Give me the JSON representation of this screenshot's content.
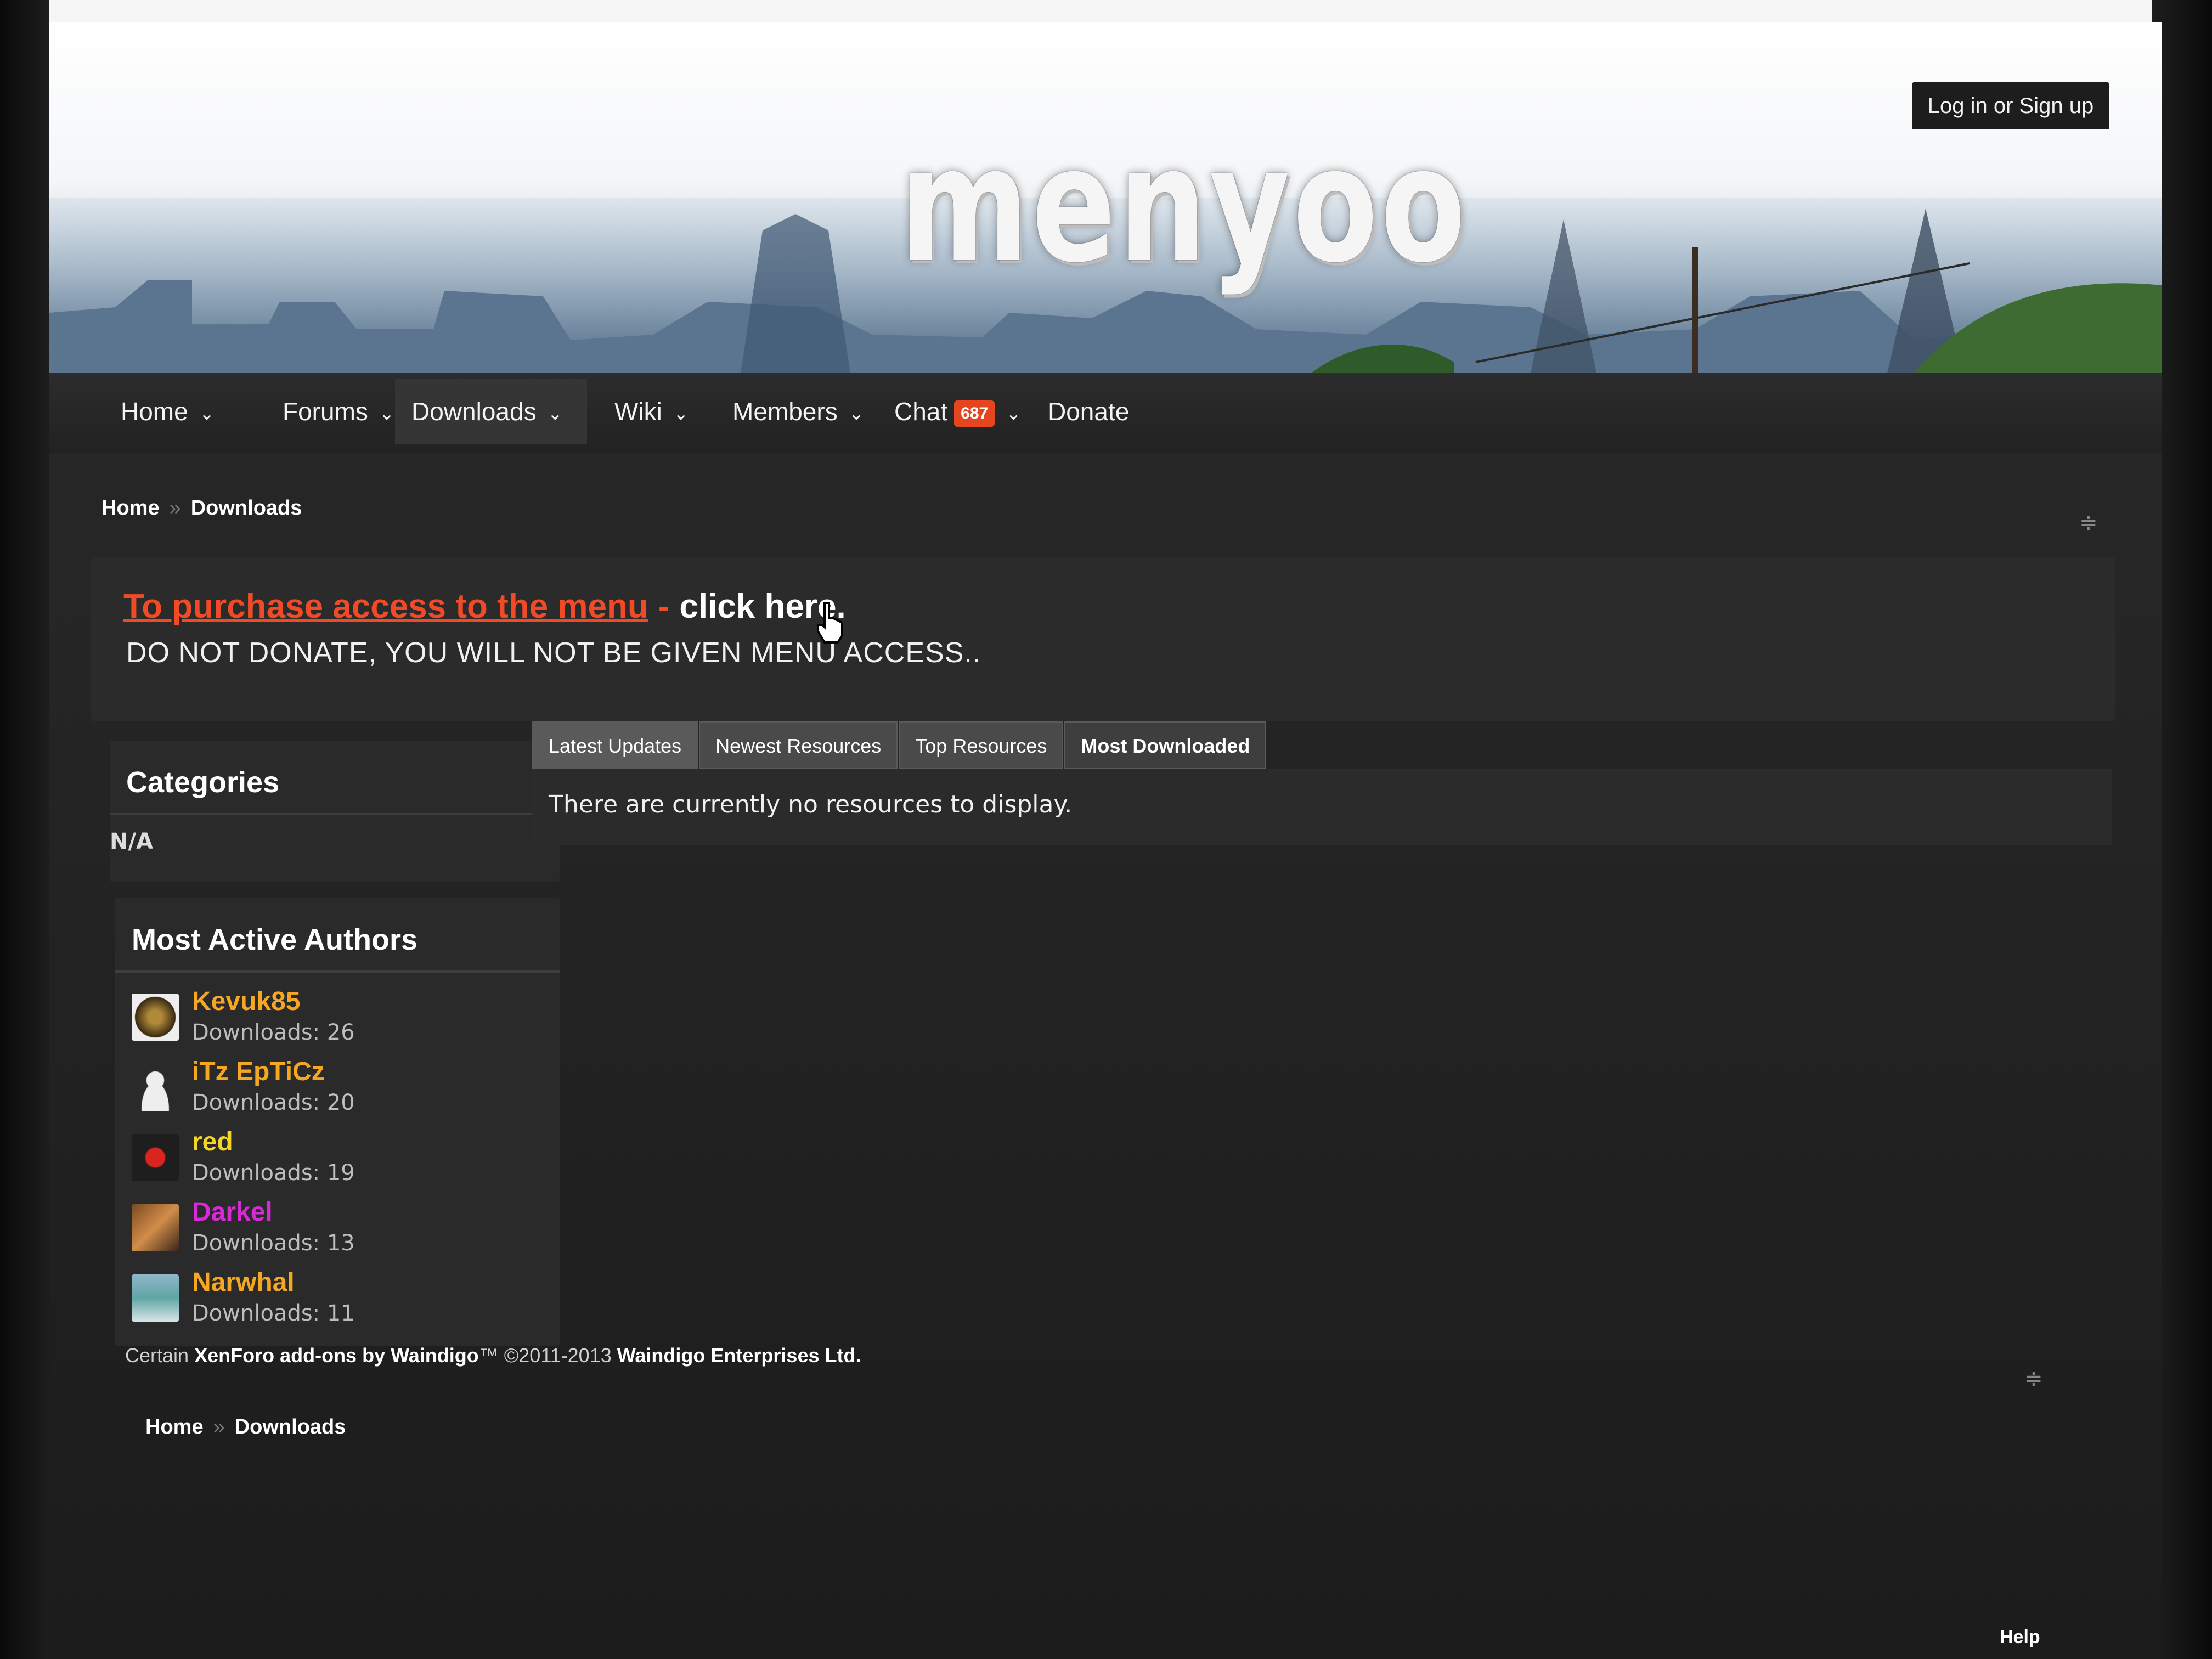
{
  "header": {
    "logo": "menyoo",
    "login_label": "Log in or Sign up"
  },
  "nav": {
    "items": [
      {
        "label": "Home",
        "has_dropdown": true
      },
      {
        "label": "Forums",
        "has_dropdown": true
      },
      {
        "label": "Downloads",
        "has_dropdown": true,
        "active": true
      },
      {
        "label": "Wiki",
        "has_dropdown": true
      },
      {
        "label": "Members",
        "has_dropdown": true
      },
      {
        "label": "Chat",
        "has_dropdown": true,
        "badge": "687"
      },
      {
        "label": "Donate",
        "has_dropdown": false
      }
    ]
  },
  "breadcrumb": {
    "items": [
      "Home",
      "Downloads"
    ]
  },
  "notice": {
    "link_text": "To purchase access to the menu",
    "dash": "-",
    "click_text": "click here.",
    "warning": "DO NOT DONATE, YOU WILL NOT BE GIVEN MENU ACCESS.."
  },
  "sidebar": {
    "categories_title": "Categories",
    "categories_value": "N/A",
    "authors_title": "Most Active Authors",
    "authors": [
      {
        "name": "Kevuk85",
        "downloads": "Downloads: 26",
        "color": "#f5a623"
      },
      {
        "name": "iTz EpTiCz",
        "downloads": "Downloads: 20",
        "color": "#f5a623"
      },
      {
        "name": "red",
        "downloads": "Downloads: 19",
        "color": "#f5d623"
      },
      {
        "name": "Darkel",
        "downloads": "Downloads: 13",
        "color": "#d62ad6"
      },
      {
        "name": "Narwhal",
        "downloads": "Downloads: 11",
        "color": "#f5a623"
      }
    ]
  },
  "tabs": {
    "items": [
      "Latest Updates",
      "Newest Resources",
      "Top Resources",
      "Most Downloaded"
    ]
  },
  "content": {
    "empty_message": "There are currently no resources to display."
  },
  "footer": {
    "credit_prefix": "Certain",
    "credit_addons": "XenForo add-ons by Waindigo",
    "credit_tm": "™ ©2011-2013",
    "credit_company": "Waindigo Enterprises Ltd.",
    "help": "Help"
  },
  "colors": {
    "accent": "#f04b26",
    "badge": "#e5451f"
  }
}
